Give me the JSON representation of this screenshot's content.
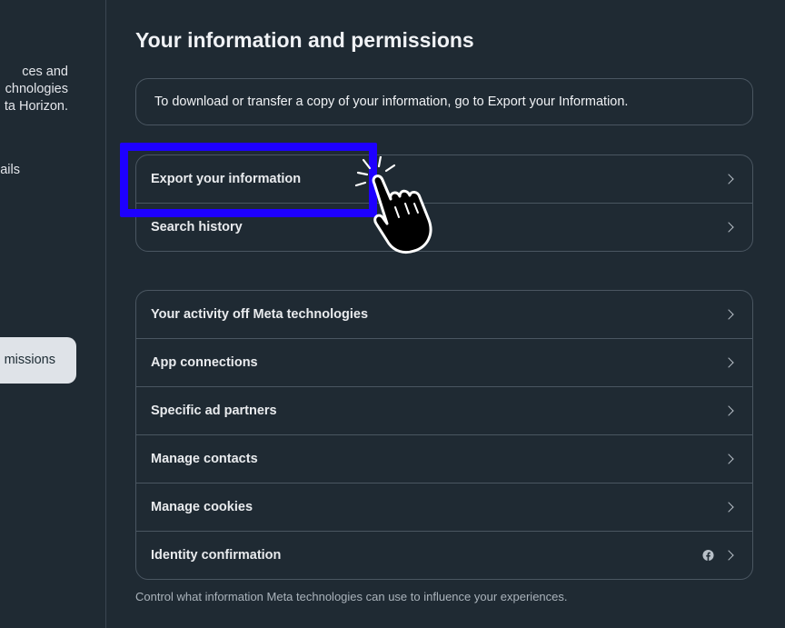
{
  "sidebar": {
    "desc_lines": [
      "ces and",
      "chnologies",
      "ta Horizon."
    ],
    "details_label": "ails",
    "active_item_label": "missions"
  },
  "main": {
    "title": "Your information and permissions",
    "banner_text": "To download or transfer a copy of your information, go to Export your Information.",
    "group1": [
      {
        "label": "Export your information"
      },
      {
        "label": "Search history"
      }
    ],
    "group2": [
      {
        "label": "Your activity off Meta technologies"
      },
      {
        "label": "App connections"
      },
      {
        "label": "Specific ad partners"
      },
      {
        "label": "Manage contacts"
      },
      {
        "label": "Manage cookies"
      },
      {
        "label": "Identity confirmation",
        "icon": "facebook-icon"
      }
    ],
    "footnote": "Control what information Meta technologies can use to influence your experiences."
  },
  "colors": {
    "background": "#1f2a33",
    "highlight": "#1e00ff",
    "active_item_bg": "#dfe3e8"
  }
}
